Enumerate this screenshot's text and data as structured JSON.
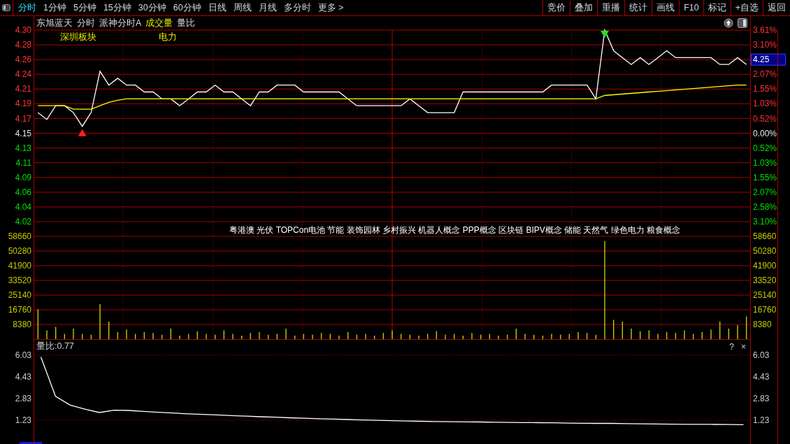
{
  "toolbar": {
    "periods": [
      {
        "label": "分时",
        "selected": true
      },
      {
        "label": "1分钟",
        "selected": false
      },
      {
        "label": "5分钟",
        "selected": false
      },
      {
        "label": "15分钟",
        "selected": false
      },
      {
        "label": "30分钟",
        "selected": false
      },
      {
        "label": "60分钟",
        "selected": false
      },
      {
        "label": "日线",
        "selected": false
      },
      {
        "label": "周线",
        "selected": false
      },
      {
        "label": "月线",
        "selected": false
      },
      {
        "label": "多分时",
        "selected": false
      },
      {
        "label": "更多 >",
        "selected": false
      }
    ],
    "actions": [
      "竞价",
      "叠加",
      "重播",
      "统计",
      "画线",
      "F10",
      "标记",
      "+自选",
      "返回"
    ]
  },
  "header": {
    "items": [
      {
        "label": "东旭蓝天",
        "selected": false
      },
      {
        "label": "分时",
        "selected": false
      },
      {
        "label": "派神分时A",
        "selected": false
      },
      {
        "label": "成交量",
        "selected": true
      },
      {
        "label": "量比",
        "selected": false
      }
    ]
  },
  "price_chart": {
    "sectors": [
      "深圳板块",
      "电力"
    ],
    "percent_axis": [
      {
        "kind": "tick",
        "label": "3.61%",
        "color": "#ff3232"
      },
      {
        "kind": "tick",
        "label": "3.10%",
        "color": "#ff3232"
      },
      {
        "kind": "price_tag",
        "label": "4.25",
        "color": "#ff3232"
      },
      {
        "kind": "tick",
        "label": "2.07%",
        "color": "#ff3232"
      },
      {
        "kind": "tick",
        "label": "1.55%",
        "color": "#ff3232"
      },
      {
        "kind": "tick",
        "label": "1.03%",
        "color": "#ff3232"
      },
      {
        "kind": "tick",
        "label": "0.52%",
        "color": "#ff3232"
      },
      {
        "kind": "tick",
        "label": "0.00%",
        "color": "#e6e6e6"
      },
      {
        "kind": "tick",
        "label": "0.52%",
        "color": "#00e000"
      },
      {
        "kind": "tick",
        "label": "1.03%",
        "color": "#00e000"
      },
      {
        "kind": "tick",
        "label": "1.55%",
        "color": "#00e000"
      },
      {
        "kind": "tick",
        "label": "2.07%",
        "color": "#00e000"
      },
      {
        "kind": "tick",
        "label": "2.58%",
        "color": "#00e000"
      },
      {
        "kind": "tick",
        "label": "3.10%",
        "color": "#00e000"
      }
    ],
    "chart_data": {
      "type": "line",
      "grid": true,
      "ylim": [
        4.0215,
        4.3
      ],
      "categories": [
        null,
        null,
        null,
        null,
        null,
        null,
        null,
        null,
        null,
        null,
        null,
        null,
        null,
        null,
        null,
        null,
        null,
        null,
        null,
        null,
        null,
        null,
        null,
        null,
        null,
        null,
        null,
        null,
        null,
        null,
        null,
        null,
        null,
        null,
        null,
        null,
        null,
        null,
        null,
        null,
        null,
        null,
        null,
        null,
        null,
        null,
        null,
        null,
        null,
        null,
        null,
        null,
        null,
        null,
        null,
        null,
        null,
        null,
        null,
        null,
        null,
        null,
        null,
        null,
        null,
        null,
        null,
        null,
        null,
        null,
        null,
        null,
        null,
        null,
        null,
        null,
        null,
        null,
        null,
        null,
        null
      ],
      "series": [
        {
          "color": "#ffffff",
          "values": [
            4.18,
            4.17,
            4.19,
            4.19,
            4.18,
            4.16,
            4.18,
            4.24,
            4.22,
            4.23,
            4.22,
            4.22,
            4.21,
            4.21,
            4.2,
            4.2,
            4.19,
            4.2,
            4.21,
            4.21,
            4.22,
            4.21,
            4.21,
            4.2,
            4.19,
            4.21,
            4.21,
            4.22,
            4.22,
            4.22,
            4.21,
            4.21,
            4.21,
            4.21,
            4.21,
            4.2,
            4.19,
            4.19,
            4.19,
            4.19,
            4.19,
            4.19,
            4.2,
            4.19,
            4.18,
            4.18,
            4.18,
            4.18,
            4.21,
            4.21,
            4.21,
            4.21,
            4.21,
            4.21,
            4.21,
            4.21,
            4.21,
            4.21,
            4.22,
            4.22,
            4.22,
            4.22,
            4.22,
            4.2,
            4.3,
            4.27,
            4.26,
            4.25,
            4.26,
            4.25,
            4.26,
            4.27,
            4.26,
            4.26,
            4.26,
            4.26,
            4.26,
            4.25,
            4.25,
            4.26,
            4.25
          ]
        },
        {
          "color": "#ffff00",
          "values": [
            4.19,
            4.19,
            4.19,
            4.19,
            4.185,
            4.185,
            4.185,
            4.19,
            4.195,
            4.198,
            4.2,
            4.2,
            4.2,
            4.2,
            4.2,
            4.2,
            4.2,
            4.2,
            4.2,
            4.2,
            4.2,
            4.2,
            4.2,
            4.2,
            4.2,
            4.2,
            4.2,
            4.2,
            4.2,
            4.2,
            4.2,
            4.2,
            4.2,
            4.2,
            4.2,
            4.2,
            4.2,
            4.2,
            4.2,
            4.2,
            4.2,
            4.2,
            4.2,
            4.2,
            4.2,
            4.2,
            4.2,
            4.2,
            4.2,
            4.2,
            4.2,
            4.2,
            4.2,
            4.2,
            4.2,
            4.2,
            4.2,
            4.2,
            4.2,
            4.2,
            4.2,
            4.2,
            4.2,
            4.2,
            4.205,
            4.206,
            4.207,
            4.208,
            4.209,
            4.21,
            4.211,
            4.212,
            4.213,
            4.214,
            4.215,
            4.216,
            4.217,
            4.218,
            4.219,
            4.22,
            4.22
          ]
        }
      ],
      "yticks": [
        {
          "value": 4.3,
          "label": "4.30"
        },
        {
          "value": 4.2785,
          "label": "4.28"
        },
        {
          "value": 4.2571,
          "label": "4.26"
        },
        {
          "value": 4.2357,
          "label": "4.24"
        },
        {
          "value": 4.2143,
          "label": "4.21"
        },
        {
          "value": 4.1928,
          "label": "4.19"
        },
        {
          "value": 4.1714,
          "label": "4.17"
        },
        {
          "value": 4.15,
          "label": "4.15"
        },
        {
          "value": 4.1286,
          "label": "4.13"
        },
        {
          "value": 4.1072,
          "label": "4.11"
        },
        {
          "value": 4.0858,
          "label": "4.09"
        },
        {
          "value": 4.0643,
          "label": "4.06"
        },
        {
          "value": 4.0429,
          "label": "4.04"
        },
        {
          "value": 4.0215,
          "label": "4.02"
        }
      ]
    }
  },
  "volume_chart": {
    "concepts": "粤港澳 光伏 TOPCon电池 节能 装饰园林 乡村振兴 机器人概念 PPP概念 区块链 BIPV概念 储能 天然气 绿色电力 粮食概念",
    "right_ticks": [
      "58660",
      "50280",
      "41900",
      "33520",
      "25140",
      "16760",
      "8380"
    ],
    "chart_data": {
      "type": "bar",
      "grid": true,
      "ylim": [
        0,
        67040
      ],
      "categories": [
        null,
        null,
        null,
        null,
        null,
        null,
        null,
        null,
        null,
        null,
        null,
        null,
        null,
        null,
        null,
        null,
        null,
        null,
        null,
        null,
        null,
        null,
        null,
        null,
        null,
        null,
        null,
        null,
        null,
        null,
        null,
        null,
        null,
        null,
        null,
        null,
        null,
        null,
        null,
        null,
        null,
        null,
        null,
        null,
        null,
        null,
        null,
        null,
        null,
        null,
        null,
        null,
        null,
        null,
        null,
        null,
        null,
        null,
        null,
        null,
        null,
        null,
        null,
        null,
        null,
        null,
        null,
        null,
        null,
        null,
        null,
        null,
        null,
        null,
        null,
        null,
        null,
        null,
        null,
        null,
        null
      ],
      "yticks": [
        {
          "value": 58660,
          "label": "58660"
        },
        {
          "value": 50280,
          "label": "50280"
        },
        {
          "value": 41900,
          "label": "41900"
        },
        {
          "value": 33520,
          "label": "33520"
        },
        {
          "value": 25140,
          "label": "25140"
        },
        {
          "value": 16760,
          "label": "16760"
        },
        {
          "value": 8380,
          "label": "8380"
        }
      ],
      "series": [
        {
          "color": "#c8c800",
          "values": [
            17000,
            5000,
            7000,
            3000,
            6000,
            3000,
            2500,
            20000,
            10000,
            4000,
            5500,
            3000,
            4000,
            3500,
            2500,
            6000,
            2000,
            3000,
            4500,
            3000,
            2500,
            5000,
            3000,
            2000,
            3500,
            4000,
            2500,
            3000,
            6000,
            2000,
            3000,
            2500,
            3500,
            3000,
            2000,
            4000,
            2500,
            3000,
            2000,
            3500,
            5000,
            3000,
            2500,
            2000,
            3000,
            4500,
            2500,
            3000,
            2000,
            3500,
            2500,
            3000,
            2000,
            2500,
            6000,
            3000,
            2500,
            2000,
            3000,
            2500,
            3000,
            4000,
            3500,
            2500,
            56000,
            11000,
            10000,
            6000,
            4500,
            5000,
            3000,
            4000,
            3500,
            5000,
            3000,
            4000,
            5500,
            10000,
            6000,
            8000,
            13000
          ]
        }
      ]
    }
  },
  "ratio_chart": {
    "label": "量比:0.77",
    "help": "?",
    "close": "×",
    "right_ticks": [
      "6.03",
      "4.43",
      "2.83",
      "1.23"
    ],
    "chart_data": {
      "type": "line",
      "grid": true,
      "ylim": [
        -0.525,
        6.185
      ],
      "categories": [
        null,
        null,
        null,
        null,
        null,
        null,
        null,
        null,
        null,
        null,
        null,
        null,
        null,
        null,
        null,
        null,
        null,
        null,
        null,
        null,
        null,
        null,
        null,
        null,
        null,
        null,
        null,
        null,
        null,
        null,
        null,
        null,
        null,
        null,
        null,
        null,
        null,
        null,
        null,
        null,
        null,
        null,
        null,
        null,
        null,
        null,
        null,
        null,
        null
      ],
      "yticks": [
        {
          "value": 6.03,
          "label": "6.03"
        },
        {
          "value": 4.43,
          "label": "4.43"
        },
        {
          "value": 2.83,
          "label": "2.83"
        },
        {
          "value": 1.23,
          "label": "1.23"
        }
      ],
      "series": [
        {
          "color": "#ffffff",
          "values": [
            5.9,
            3.0,
            2.35,
            2.05,
            1.8,
            1.97,
            1.95,
            1.88,
            1.82,
            1.76,
            1.7,
            1.66,
            1.62,
            1.57,
            1.53,
            1.49,
            1.45,
            1.41,
            1.38,
            1.34,
            1.31,
            1.28,
            1.25,
            1.22,
            1.2,
            1.17,
            1.15,
            1.13,
            1.12,
            1.11,
            1.1,
            1.08,
            1.07,
            1.06,
            1.05,
            1.04,
            1.02,
            1.01,
            1.0,
            1.0,
            0.98,
            0.96,
            0.95,
            0.94,
            0.93,
            0.93,
            0.92,
            0.91,
            0.9
          ]
        }
      ]
    }
  }
}
